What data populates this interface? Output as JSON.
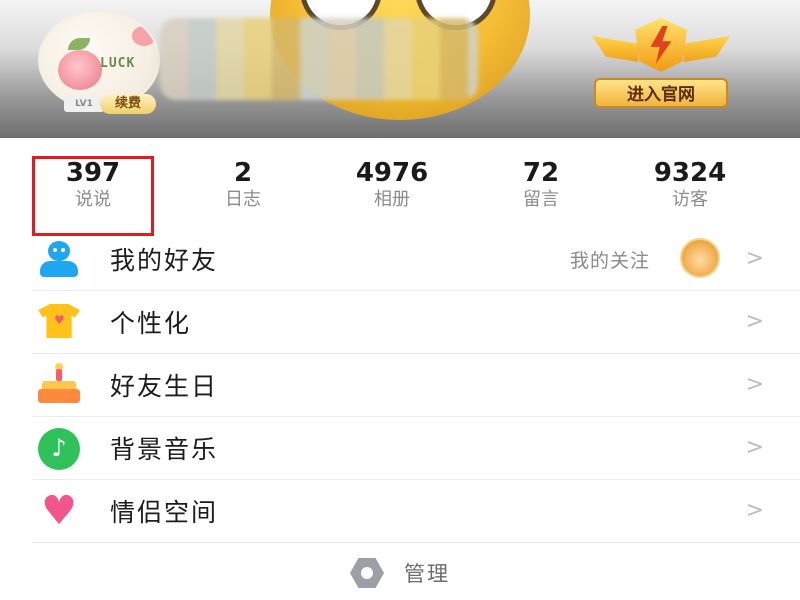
{
  "header": {
    "avatar_text": "LUCK",
    "level_badge": "LV1",
    "renew_label": "续费",
    "official_site_label": "进入官网"
  },
  "stats": [
    {
      "value": "397",
      "label": "说说",
      "highlighted": true
    },
    {
      "value": "2",
      "label": "日志",
      "highlighted": false
    },
    {
      "value": "4976",
      "label": "相册",
      "highlighted": false
    },
    {
      "value": "72",
      "label": "留言",
      "highlighted": false
    },
    {
      "value": "9324",
      "label": "访客",
      "highlighted": false
    }
  ],
  "menu": {
    "items": [
      {
        "label": "我的好友",
        "icon": "friends-icon",
        "sub": "我的关注"
      },
      {
        "label": "个性化",
        "icon": "shirt-icon"
      },
      {
        "label": "好友生日",
        "icon": "birthday-cake-icon"
      },
      {
        "label": "背景音乐",
        "icon": "music-icon"
      },
      {
        "label": "情侣空间",
        "icon": "heart-icon"
      }
    ],
    "chevron": ">"
  },
  "footer": {
    "manage_label": "管理",
    "icon": "settings-hex-icon"
  },
  "colors": {
    "highlight_border": "#e01c1c",
    "friends_icon": "#1ea6f0",
    "music_icon": "#2fc25b",
    "heart_icon": "#f2548c"
  }
}
